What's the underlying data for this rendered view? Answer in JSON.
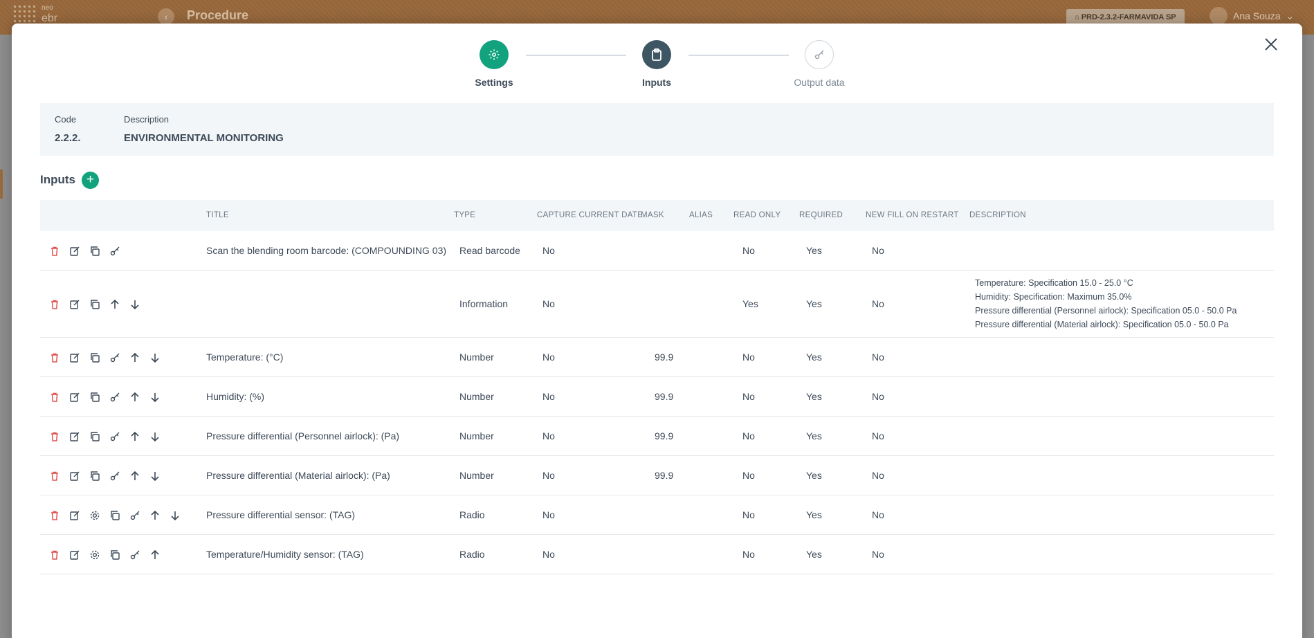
{
  "app": {
    "logo_top": "neo",
    "logo_bottom": "ebr",
    "title": "Procedure",
    "env_badge": "PRD-2.3.2-FARMAVIDA SP",
    "user_name": "Ana Souza"
  },
  "stepper": [
    {
      "label": "Settings",
      "icon": "gear-icon"
    },
    {
      "label": "Inputs",
      "icon": "clipboard-icon"
    },
    {
      "label": "Output data",
      "icon": "key-icon"
    }
  ],
  "procedure": {
    "code_label": "Code",
    "code_value": "2.2.2.",
    "description_label": "Description",
    "description_value": "ENVIRONMENTAL MONITORING"
  },
  "inputs": {
    "section_title": "Inputs",
    "add_label": "+",
    "columns": [
      "TITLE",
      "TYPE",
      "CAPTURE CURRENT DATE",
      "MASK",
      "ALIAS",
      "READ ONLY",
      "REQUIRED",
      "NEW FILL ON RESTART",
      "DESCRIPTION"
    ],
    "rows": [
      {
        "actions": [
          "delete",
          "edit",
          "copy",
          "key"
        ],
        "title": "Scan the blending room barcode: (COMPOUNDING 03)",
        "type": "Read barcode",
        "capture_date": "No",
        "mask": "",
        "alias": "",
        "read_only": "No",
        "required": "Yes",
        "new_fill": "No",
        "description": []
      },
      {
        "actions": [
          "delete",
          "edit",
          "copy",
          "up",
          "down"
        ],
        "title": "",
        "type": "Information",
        "capture_date": "No",
        "mask": "",
        "alias": "",
        "read_only": "Yes",
        "required": "Yes",
        "new_fill": "No",
        "description": [
          "Temperature: Specification 15.0 - 25.0 °C",
          "Humidity: Specification: Maximum 35.0%",
          "Pressure differential (Personnel airlock): Specification 05.0 - 50.0 Pa",
          "Pressure differential (Material airlock): Specification 05.0 - 50.0 Pa"
        ]
      },
      {
        "actions": [
          "delete",
          "edit",
          "copy",
          "key",
          "up",
          "down"
        ],
        "title": "Temperature: (°C)",
        "type": "Number",
        "capture_date": "No",
        "mask": "99.9",
        "alias": "",
        "read_only": "No",
        "required": "Yes",
        "new_fill": "No",
        "description": []
      },
      {
        "actions": [
          "delete",
          "edit",
          "copy",
          "key",
          "up",
          "down"
        ],
        "title": "Humidity: (%)",
        "type": "Number",
        "capture_date": "No",
        "mask": "99.9",
        "alias": "",
        "read_only": "No",
        "required": "Yes",
        "new_fill": "No",
        "description": []
      },
      {
        "actions": [
          "delete",
          "edit",
          "copy",
          "key",
          "up",
          "down"
        ],
        "title": "Pressure differential (Personnel airlock): (Pa)",
        "type": "Number",
        "capture_date": "No",
        "mask": "99.9",
        "alias": "",
        "read_only": "No",
        "required": "Yes",
        "new_fill": "No",
        "description": []
      },
      {
        "actions": [
          "delete",
          "edit",
          "copy",
          "key",
          "up",
          "down"
        ],
        "title": "Pressure differential (Material airlock): (Pa)",
        "type": "Number",
        "capture_date": "No",
        "mask": "99.9",
        "alias": "",
        "read_only": "No",
        "required": "Yes",
        "new_fill": "No",
        "description": []
      },
      {
        "actions": [
          "delete",
          "edit",
          "settings",
          "copy",
          "key",
          "up",
          "down"
        ],
        "title": "Pressure differential sensor: (TAG)",
        "type": "Radio",
        "capture_date": "No",
        "mask": "",
        "alias": "",
        "read_only": "No",
        "required": "Yes",
        "new_fill": "No",
        "description": []
      },
      {
        "actions": [
          "delete",
          "edit",
          "settings",
          "copy",
          "key",
          "up"
        ],
        "title": "Temperature/Humidity sensor: (TAG)",
        "type": "Radio",
        "capture_date": "No",
        "mask": "",
        "alias": "",
        "read_only": "No",
        "required": "Yes",
        "new_fill": "No",
        "description": []
      }
    ]
  },
  "colors": {
    "accent": "#12a27e",
    "step_active": "#3e5664",
    "danger": "#e0524f",
    "header_bg": "#9a6a3e"
  }
}
